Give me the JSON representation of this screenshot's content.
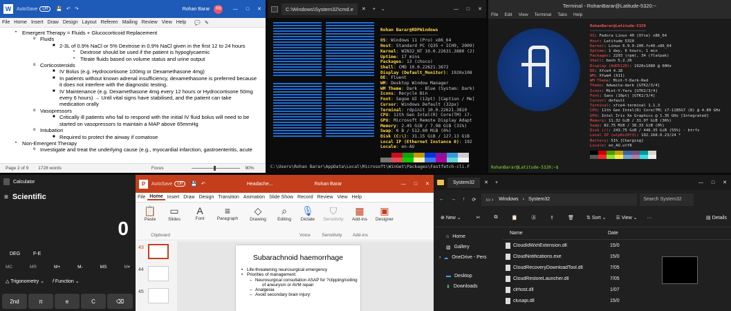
{
  "word": {
    "autosave": "AutoSave",
    "autosave_state": "Off",
    "user": "Rohan Barar",
    "initials": "RB",
    "menu": [
      "File",
      "Home",
      "Insert",
      "Draw",
      "Design",
      "Layout",
      "Referen",
      "Mailing",
      "Review",
      "View",
      "Help"
    ],
    "lines": [
      {
        "lvl": 1,
        "b": "•",
        "t": "Emergent Therapy = Fluids + Glucocorticoid Replacement"
      },
      {
        "lvl": 2,
        "b": "o",
        "t": "Fluids"
      },
      {
        "lvl": 3,
        "b": "■",
        "t": "2-3L of 0.9% NaCl or 5% Dextrose in 0.9% NaCl given in the first 12 to 24 hours"
      },
      {
        "lvl": 4,
        "b": "•",
        "t": "Dextrose should be used if the patient is hypoglycaemic"
      },
      {
        "lvl": 4,
        "b": "•",
        "t": "Titrate fluids based on volume status and urine output"
      },
      {
        "lvl": 2,
        "b": "o",
        "t": "Corticosteroids"
      },
      {
        "lvl": 3,
        "b": "■",
        "t": "IV Bolus (e.g. Hydrocortisone 100mg or Dexamethasone 4mg)"
      },
      {
        "lvl": 3,
        "b": "■",
        "t": "In patients without known adrenal insufficiency, dexamethasone is preferred because"
      },
      {
        "lvl": 3,
        "b": "",
        "t": "it does not interfere with the diagnostic testing."
      },
      {
        "lvl": 3,
        "b": "■",
        "t": "IV Maintenance (e.g. Dexamethasone 4mg every 12 hours or Hydrocortisone 50mg"
      },
      {
        "lvl": 3,
        "b": "",
        "t": "every 6 hours) → Until vital signs have stabilised, and the patient can take"
      },
      {
        "lvl": 3,
        "b": "",
        "t": "medication orally"
      },
      {
        "lvl": 2,
        "b": "o",
        "t": "Vasopressors"
      },
      {
        "lvl": 3,
        "b": "■",
        "t": "Critically ill patients who fail to respond with the initial IV fluid bolus will need to be"
      },
      {
        "lvl": 3,
        "b": "",
        "t": "started on vasopressors to maintain a MAP above 65mmHg"
      },
      {
        "lvl": 2,
        "b": "o",
        "t": "Intubation"
      },
      {
        "lvl": 3,
        "b": "■",
        "t": "Required to protect the airway if comatose"
      },
      {
        "lvl": 1,
        "b": "•",
        "t": "Non-Emergent Therapy"
      },
      {
        "lvl": 2,
        "b": "o",
        "t": "Investigate and treat the underlying cause (e.g., myocardial infarction, gastroenteritis, acute"
      }
    ],
    "status": {
      "page": "Page 2 of 9",
      "words": "1728 words",
      "focus": "Focus",
      "zoom": "90%"
    }
  },
  "cmd": {
    "title": "C:\\Windows\\System32\\cmd.e",
    "header": "Rohan Barar@RDPWindows",
    "info": [
      [
        "OS",
        "Windows 11 (Pro) x86_64"
      ],
      [
        "Host",
        "Standard PC (Q35 + ICH9, 2009)"
      ],
      [
        "Kernel",
        "WIN32_NT 10.0.22631.3880 (2)"
      ],
      [
        "Uptime",
        "17 mins"
      ],
      [
        "Packages",
        "13 (choco)"
      ],
      [
        "Shell",
        "CMD 10.0.22621.3672"
      ],
      [
        "Display (Default_Monitor)",
        "1920x108"
      ],
      [
        "DE",
        "Fluent"
      ],
      [
        "WM",
        "Desktop Window Manager"
      ],
      [
        "WM Theme",
        "Dark - Blue (System: Dark)"
      ],
      [
        "Icons",
        "Recycle Bin"
      ],
      [
        "Font",
        "Segoe UI (12pt) [Caption / Me]"
      ],
      [
        "Cursor",
        "Windows Default (32px)"
      ],
      [
        "Terminal",
        "rdpinit 10.0.22621.3810"
      ],
      [
        "CPU",
        "11th Gen Intel(R) Core(TM) i7-"
      ],
      [
        "GPU",
        "Microsoft Remote Display Adapt"
      ],
      [
        "Memory",
        "2.45 GiB / 7.98 GiB (31%)"
      ],
      [
        "Swap",
        "0 B / 512.00 MiB (0%)"
      ],
      [
        "Disk (C:\\)",
        "31.15 GiB / 127.13 GiB"
      ],
      [
        "Local IP (Ethernet Instance 0)",
        "192"
      ],
      [
        "Locale",
        "en-AU"
      ]
    ],
    "prompt": "C:\\Users\\Rohan Barar\\AppData\\Local\\Microsoft\\WinGet\\Packages\\Fastfetch-cli.F"
  },
  "linux": {
    "title": "Terminal - RohanBarar@Latitude-5320:~",
    "menu": [
      "File",
      "Edit",
      "View",
      "Terminal",
      "Tabs",
      "Help"
    ],
    "header": "RohanBarar@Latitude-5320",
    "info": [
      [
        "OS",
        "Fedora Linux 40 (Xfce) x86_64"
      ],
      [
        "Host",
        "Latitude 5320"
      ],
      [
        "Kernel",
        "Linux 6.9.9-200.fc40.x86_64"
      ],
      [
        "Uptime",
        "1 day, 6 hours, 1 min"
      ],
      [
        "Packages",
        "2293 (rpm), 34 (flatpak)"
      ],
      [
        "Shell",
        "bash 5.2.26"
      ],
      [
        "Display (AUO512D)",
        "1920x1080 @ 60Hz"
      ],
      [
        "DE",
        "Xfce4 4.18"
      ],
      [
        "WM",
        "Xfwm4 (X11)"
      ],
      [
        "WM Theme",
        "Mint-Y-Dark-Red"
      ],
      [
        "Theme",
        "Adwaita-dark [GTK2/3/4]"
      ],
      [
        "Icons",
        "Mint-Y-Yaru [GTK2/3/4]"
      ],
      [
        "Font",
        "Sans (10pt) [GTK2/3/4]"
      ],
      [
        "Cursor",
        "default"
      ],
      [
        "Terminal",
        "xfce4-terminal 1.1.3"
      ],
      [
        "CPU",
        "11th Gen Intel(R) Core(TM) i7-1185G7 (8) @ 4.80 GHz"
      ],
      [
        "GPU",
        "Intel Iris Xe Graphics @ 1.35 GHz [Integrated]"
      ],
      [
        "Memory",
        "11.32 GiB / 31.07 GiB (36%)"
      ],
      [
        "Swap",
        "82.75 MiB / 38.33 GiB (0%)"
      ],
      [
        "Disk (/)",
        "243.75 GiB / 446.35 GiB (55%) - btrfs"
      ],
      [
        "Local IP (wlp0s20f3)",
        "192.168.0.23/24 *"
      ],
      [
        "Battery",
        "51% [Charging]"
      ],
      [
        "Locale",
        "en_AU.utf8"
      ]
    ],
    "prompt": "RohanBarar@Latitude-5320:~$"
  },
  "calc": {
    "app": "Calculator",
    "mode": "Scientific",
    "display": "0",
    "deg": "DEG",
    "fe": "F-E",
    "mem": [
      "MC",
      "MR",
      "M+",
      "M-",
      "MS",
      "M▾"
    ],
    "trig": "Trigonometry",
    "func": "Function",
    "keys": [
      "2nd",
      "π",
      "e",
      "C",
      "⌫"
    ]
  },
  "ppt": {
    "autosave": "AutoSave",
    "autosave_state": "Off",
    "file": "Headache...",
    "user": "Rohan Barar",
    "menu": [
      "File",
      "Home",
      "Insert",
      "Draw",
      "Design",
      "Transition",
      "Animation",
      "Slide Show",
      "Record",
      "Review",
      "View",
      "Help"
    ],
    "ribbon": [
      "Paste",
      "Slides",
      "Font",
      "Paragraph",
      "Drawing",
      "Editing",
      "Dictate",
      "Sensitivity",
      "Add-ins",
      "Designer"
    ],
    "groups": [
      "Clipboard",
      "Voice",
      "Sensitivity",
      "Add-ins"
    ],
    "thumbs": [
      "43",
      "44",
      "45"
    ],
    "slide_title": "Subarachnoid haemorrhage",
    "slide_lines": [
      {
        "lvl": 1,
        "t": "Life-threatening neurosurgical emergency"
      },
      {
        "lvl": 1,
        "t": "Priorities of management:"
      },
      {
        "lvl": 2,
        "t": "Neurosurgical consultation ASAP for ?clipping/coiling"
      },
      {
        "lvl": 3,
        "t": "of aneurysm or AVM repair"
      },
      {
        "lvl": 2,
        "t": "Analgesia"
      },
      {
        "lvl": 2,
        "t": "Avoid secondary brain injury:"
      }
    ]
  },
  "explorer": {
    "title": "System32",
    "path": [
      "Windows",
      "System32"
    ],
    "search": "Search System32",
    "new": "New",
    "sort": "Sort",
    "view": "View",
    "details": "Details",
    "nav": [
      "Home",
      "Gallery",
      "OneDrive - Pers",
      "Desktop",
      "Downloads"
    ],
    "col_name": "Name",
    "col_date": "Date",
    "files": [
      {
        "n": "CloudIdWxhExtension.dll",
        "d": "15/0"
      },
      {
        "n": "CloudNotifications.exe",
        "d": "15/0"
      },
      {
        "n": "CloudRecoveryDownloadTool.dll",
        "d": "7/05"
      },
      {
        "n": "CloudRestoreLauncher.dll",
        "d": "7/05"
      },
      {
        "n": "clrhost.dll",
        "d": "1/07"
      },
      {
        "n": "clusapi.dll",
        "d": "15/0"
      }
    ]
  }
}
